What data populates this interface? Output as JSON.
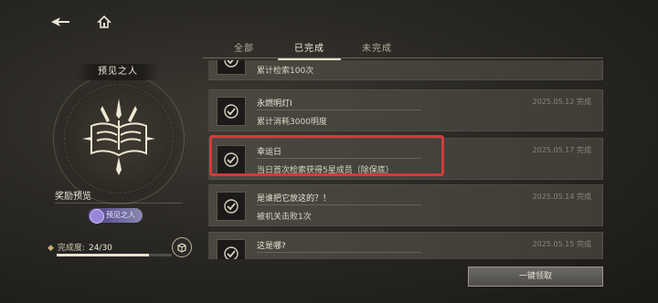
{
  "tabs": [
    {
      "label": "全部",
      "active": false
    },
    {
      "label": "已完成",
      "active": true
    },
    {
      "label": "未完成",
      "active": false
    }
  ],
  "left": {
    "title": "预见之人",
    "reward_title": "奖励预览",
    "reward_chip": "预见之人",
    "progress_label": "完成度:",
    "progress_value": "24/30",
    "progress_fraction": 0.8
  },
  "achievements": [
    {
      "name": "",
      "desc": "累计检索100次",
      "date": ""
    },
    {
      "name": "永燃明灯I",
      "desc": "累计消耗3000明度",
      "date": "2025.05.12 完成"
    },
    {
      "name": "幸运日",
      "desc": "当日首次检索获得5星成员（除保底）",
      "date": "2025.05.17 完成"
    },
    {
      "name": "是谁把它放这的？！",
      "desc": "被机关击败1次",
      "date": "2025.05.14 完成"
    },
    {
      "name": "这是哪?",
      "desc": "",
      "date": "2025.05.15 完成"
    }
  ],
  "footer": {
    "claim_all_label": "一键领取"
  },
  "icons": {
    "back": "back-arrow-icon",
    "home": "home-icon",
    "chest": "chest-icon"
  },
  "colors": {
    "highlight": "#d13b3b"
  }
}
